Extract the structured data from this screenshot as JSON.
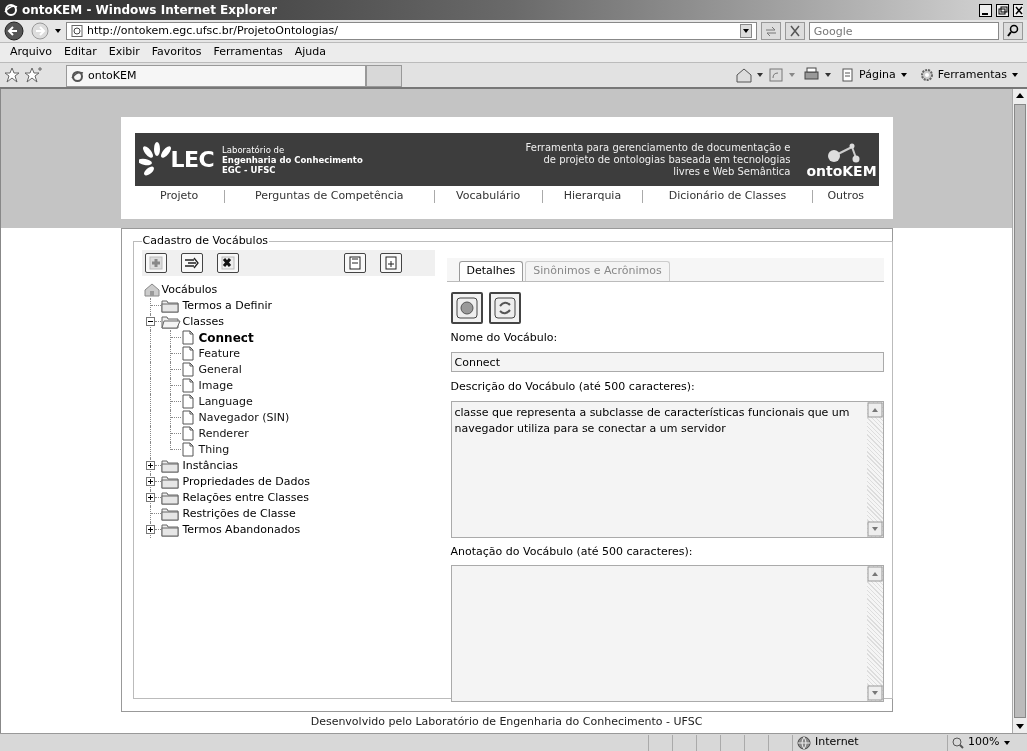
{
  "window": {
    "title": "ontoKEM - Windows Internet Explorer"
  },
  "address_bar": {
    "url": "http://ontokem.egc.ufsc.br/ProjetoOntologias/",
    "search_placeholder": "Google"
  },
  "menu": [
    "Arquivo",
    "Editar",
    "Exibir",
    "Favoritos",
    "Ferramentas",
    "Ajuda"
  ],
  "browser_tabs": [
    {
      "label": "ontoKEM",
      "selected": true
    }
  ],
  "command_bar": [
    "Página",
    "Ferramentas"
  ],
  "banner": {
    "lab_line1": "Laboratório de",
    "lab_line2": "Engenharia do Conhecimento",
    "lab_line3": "EGC - UFSC",
    "logo_text": "LEC",
    "tagline": [
      "Ferramenta para gerenciamento de documentação e",
      "de projeto de ontologias baseada em tecnologias",
      "livres e Web Semântica"
    ],
    "product": "ontoKEM"
  },
  "nav": [
    "Projeto",
    "Perguntas de Competência",
    "Vocabulário",
    "Hierarquia",
    "Dicionário de Classes",
    "Outros"
  ],
  "panel": {
    "legend": "Cadastro de Vocábulos"
  },
  "tree": {
    "root": "Vocábulos",
    "children": [
      {
        "label": "Termos a Definir"
      },
      {
        "label": "Classes",
        "expanded": true,
        "children": [
          {
            "label": "Connect",
            "selected": true
          },
          {
            "label": "Feature",
            "selected": false
          },
          {
            "label": "General",
            "selected": false
          },
          {
            "label": "Image",
            "selected": false
          },
          {
            "label": "Language",
            "selected": false
          },
          {
            "label": "Navegador (SIN)",
            "selected": false
          },
          {
            "label": "Renderer",
            "selected": false
          },
          {
            "label": "Thing",
            "selected": false
          }
        ]
      },
      {
        "label": "Instâncias",
        "expanded": false
      },
      {
        "label": "Propriedades de Dados",
        "expanded": false
      },
      {
        "label": "Relações entre Classes",
        "expanded": false
      },
      {
        "label": "Restrições de Classe"
      },
      {
        "label": "Termos Abandonados",
        "expanded": false
      }
    ]
  },
  "detail_tabs": [
    {
      "label": "Detalhes",
      "selected": true
    },
    {
      "label": "Sinônimos e Acrônimos",
      "selected": false
    }
  ],
  "form": {
    "name_label": "Nome do Vocábulo:",
    "name_value": "Connect",
    "description_label": "Descrição do Vocábulo (até 500 caracteres):",
    "description_value": "classe que representa a subclasse de características funcionais que um navegador utiliza para se conectar a um servidor",
    "annotation_label": "Anotação do Vocábulo (até 500 caracteres):"
  },
  "footer": "Desenvolvido pelo Laboratório de Engenharia do Conhecimento - UFSC",
  "status_bar": {
    "zone": "Internet",
    "zoom": "100%"
  }
}
